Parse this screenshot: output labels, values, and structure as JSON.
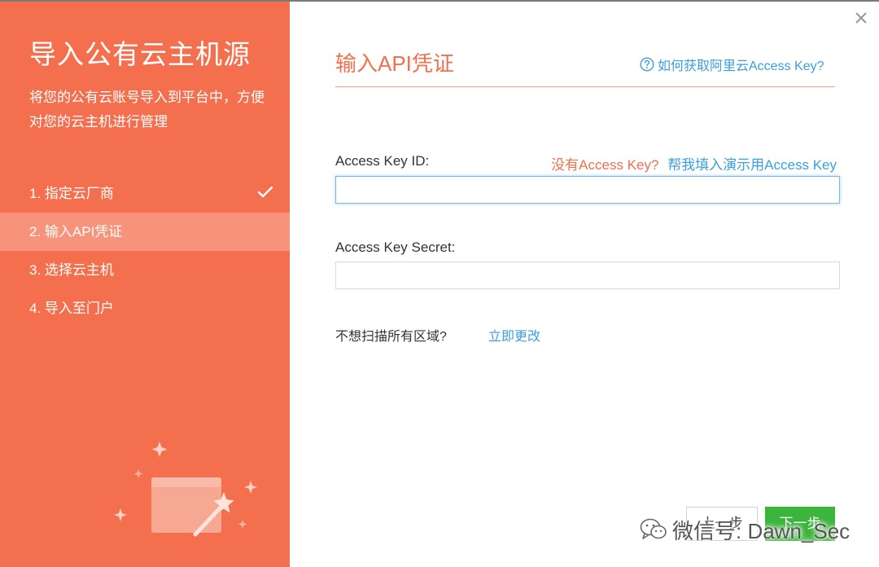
{
  "sidebar": {
    "title": "导入公有云主机源",
    "description": "将您的公有云账号导入到平台中，方便对您的云主机进行管理",
    "steps": [
      {
        "label": "1. 指定云厂商",
        "state": "done"
      },
      {
        "label": "2. 输入API凭证",
        "state": "active"
      },
      {
        "label": "3. 选择云主机",
        "state": "pending"
      },
      {
        "label": "4. 导入至门户",
        "state": "pending"
      }
    ]
  },
  "main": {
    "title": "输入API凭证",
    "help_link": "如何获取阿里云Access Key?",
    "access_key_id": {
      "label": "Access Key ID:",
      "value": "",
      "placeholder": ""
    },
    "no_key_text": "没有Access Key?",
    "demo_fill_link": "帮我填入演示用Access Key",
    "access_key_secret": {
      "label": "Access Key Secret:",
      "value": "",
      "placeholder": ""
    },
    "region_question": "不想扫描所有区域?",
    "region_change_link": "立即更改"
  },
  "footer": {
    "prev_button": "上一步",
    "next_button": "下一步"
  },
  "watermark": {
    "text": "微信号: Dawn_Sec"
  },
  "colors": {
    "accent": "#f36f4e",
    "link": "#3a9fe0",
    "primary_button": "#3cb53c"
  },
  "icons": [
    "close-icon",
    "check-icon",
    "question-circle-icon",
    "wechat-icon"
  ]
}
